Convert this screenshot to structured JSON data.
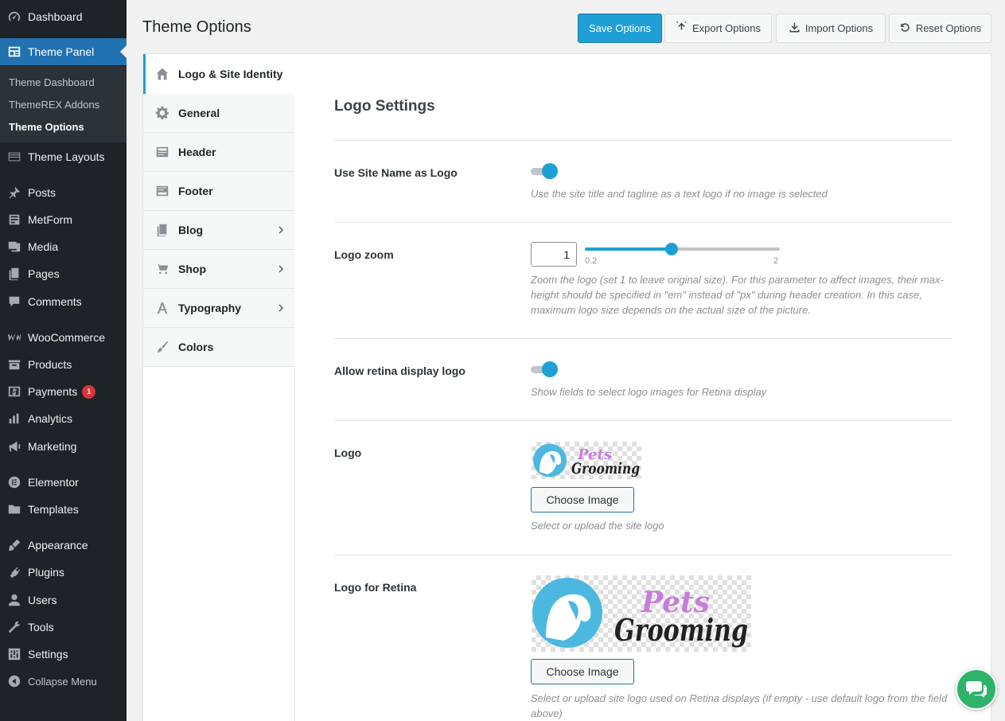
{
  "sidebar": {
    "items": [
      {
        "label": "Dashboard",
        "icon": "dashboard-icon"
      },
      {
        "label": "Theme Panel",
        "icon": "theme-panel-icon",
        "active": true
      },
      {
        "label": "Theme Layouts",
        "icon": "layouts-icon"
      },
      {
        "label": "Posts",
        "icon": "pin-icon"
      },
      {
        "label": "MetForm",
        "icon": "form-icon"
      },
      {
        "label": "Media",
        "icon": "media-icon"
      },
      {
        "label": "Pages",
        "icon": "pages-icon"
      },
      {
        "label": "Comments",
        "icon": "comments-icon"
      },
      {
        "label": "WooCommerce",
        "icon": "woocommerce-icon"
      },
      {
        "label": "Products",
        "icon": "products-icon"
      },
      {
        "label": "Payments",
        "icon": "payments-icon",
        "badge": "1"
      },
      {
        "label": "Analytics",
        "icon": "analytics-icon"
      },
      {
        "label": "Marketing",
        "icon": "megaphone-icon"
      },
      {
        "label": "Elementor",
        "icon": "elementor-icon"
      },
      {
        "label": "Templates",
        "icon": "folder-icon"
      },
      {
        "label": "Appearance",
        "icon": "brush-icon"
      },
      {
        "label": "Plugins",
        "icon": "plugin-icon"
      },
      {
        "label": "Users",
        "icon": "user-icon"
      },
      {
        "label": "Tools",
        "icon": "wrench-icon"
      },
      {
        "label": "Settings",
        "icon": "settings-icon"
      },
      {
        "label": "Collapse Menu",
        "icon": "collapse-icon"
      }
    ],
    "submenu": [
      {
        "label": "Theme Dashboard"
      },
      {
        "label": "ThemeREX Addons"
      },
      {
        "label": "Theme Options",
        "current": true
      }
    ]
  },
  "header": {
    "title": "Theme Options",
    "save": "Save Options",
    "export": "Export Options",
    "import": "Import Options",
    "reset": "Reset Options"
  },
  "tabs": [
    {
      "label": "Logo & Site Identity",
      "icon": "home-icon",
      "active": true
    },
    {
      "label": "General",
      "icon": "gear-icon"
    },
    {
      "label": "Header",
      "icon": "header-icon"
    },
    {
      "label": "Footer",
      "icon": "footer-icon"
    },
    {
      "label": "Blog",
      "icon": "blog-icon",
      "has_children": true
    },
    {
      "label": "Shop",
      "icon": "cart-icon",
      "has_children": true
    },
    {
      "label": "Typography",
      "icon": "typography-icon",
      "has_children": true
    },
    {
      "label": "Colors",
      "icon": "brush-icon"
    }
  ],
  "content": {
    "section_title": "Logo Settings",
    "options": {
      "site_name_logo": {
        "label": "Use Site Name as Logo",
        "enabled": true,
        "desc": "Use the site title and tagline as a text logo if no image is selected"
      },
      "logo_zoom": {
        "label": "Logo zoom",
        "value": "1",
        "min": "0.2",
        "max": "2",
        "desc": "Zoom the logo (set 1 to leave original size). For this parameter to affect images, their max-height should be specified in \"em\" instead of \"px\" during header creation. In this case, maximum logo size depends on the actual size of the picture."
      },
      "retina_logo": {
        "label": "Allow retina display logo",
        "enabled": true,
        "desc": "Show fields to select logo images for Retina display"
      },
      "logo": {
        "label": "Logo",
        "button": "Choose Image",
        "desc": "Select or upload the site logo",
        "image_text_top": "Pets",
        "image_text_bottom": "Grooming"
      },
      "logo_retina": {
        "label": "Logo for Retina",
        "button": "Choose Image",
        "desc": "Select or upload site logo used on Retina displays (if empty - use default logo from the field above)",
        "image_text_top": "Pets",
        "image_text_bottom": "Grooming"
      }
    }
  },
  "colors": {
    "accent": "#1ea0d6",
    "sidebar_bg": "#1d2327",
    "logo_blue": "#4cb8e0",
    "logo_purple": "#c77ddb",
    "chat_green": "#2fb36a"
  }
}
